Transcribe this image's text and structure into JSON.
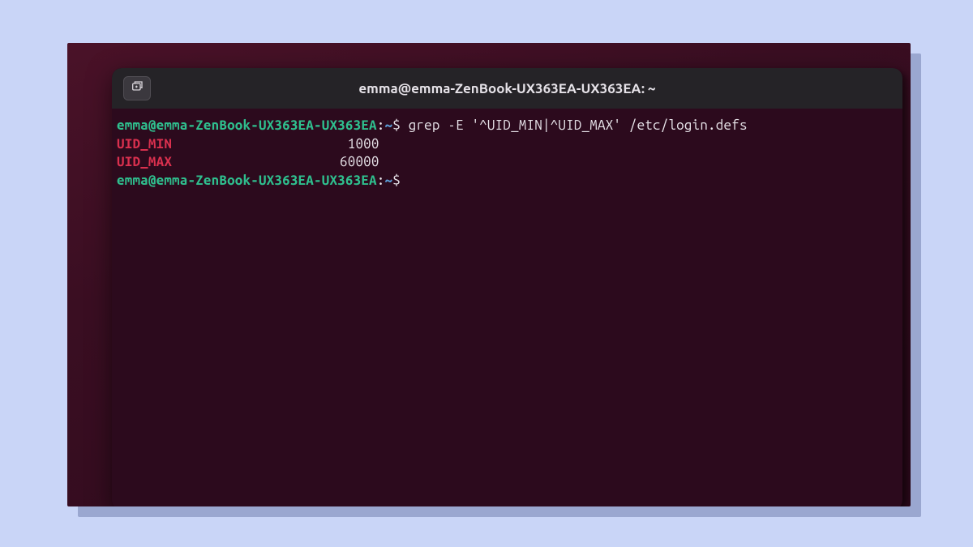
{
  "window": {
    "title": "emma@emma-ZenBook-UX363EA-UX363EA: ~"
  },
  "prompt": {
    "user_host": "emma@emma-ZenBook-UX363EA-UX363EA",
    "separator": ":",
    "path": "~",
    "symbol": "$"
  },
  "lines": {
    "cmd1": "grep -E '^UID_MIN|^UID_MAX' /etc/login.defs",
    "out1_key": "UID_MIN",
    "out1_val": " 1000",
    "out2_key": "UID_MAX",
    "out2_val": "60000",
    "cmd2": ""
  },
  "icons": {
    "newtab": "new-tab-icon"
  },
  "colors": {
    "bg_page": "#c9d5f7",
    "bg_desktop": "#3a0e22",
    "bg_terminal": "#2c0a1d",
    "bg_titlebar": "#252327",
    "prompt_green": "#2fbf8e",
    "prompt_blue": "#5a9bd4",
    "match_red": "#d9304e",
    "text": "#e8e4ea"
  }
}
